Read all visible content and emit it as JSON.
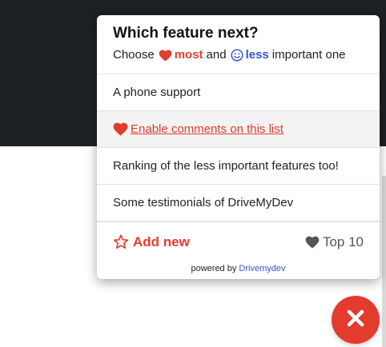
{
  "header": {
    "title": "Which feature next?",
    "choose": "Choose",
    "most": "most",
    "and": "and",
    "less": "less",
    "important_one": "important one"
  },
  "items": [
    {
      "label": "A phone support"
    },
    {
      "label": "Enable comments on this list"
    },
    {
      "label": "Ranking of the less important features too!"
    },
    {
      "label": "Some testimonials of DriveMyDev"
    }
  ],
  "footer": {
    "add_new": "Add new",
    "top": "Top 10"
  },
  "powered": {
    "prefix": "powered by",
    "brand": "Drivemydev"
  },
  "icons": {
    "heart": "heart-icon",
    "smile": "smile-icon",
    "star": "star-outline-icon",
    "close": "close-icon"
  },
  "colors": {
    "accent_red": "#e33b2e",
    "accent_blue": "#3556d4",
    "dark_bg": "#1e2124"
  }
}
